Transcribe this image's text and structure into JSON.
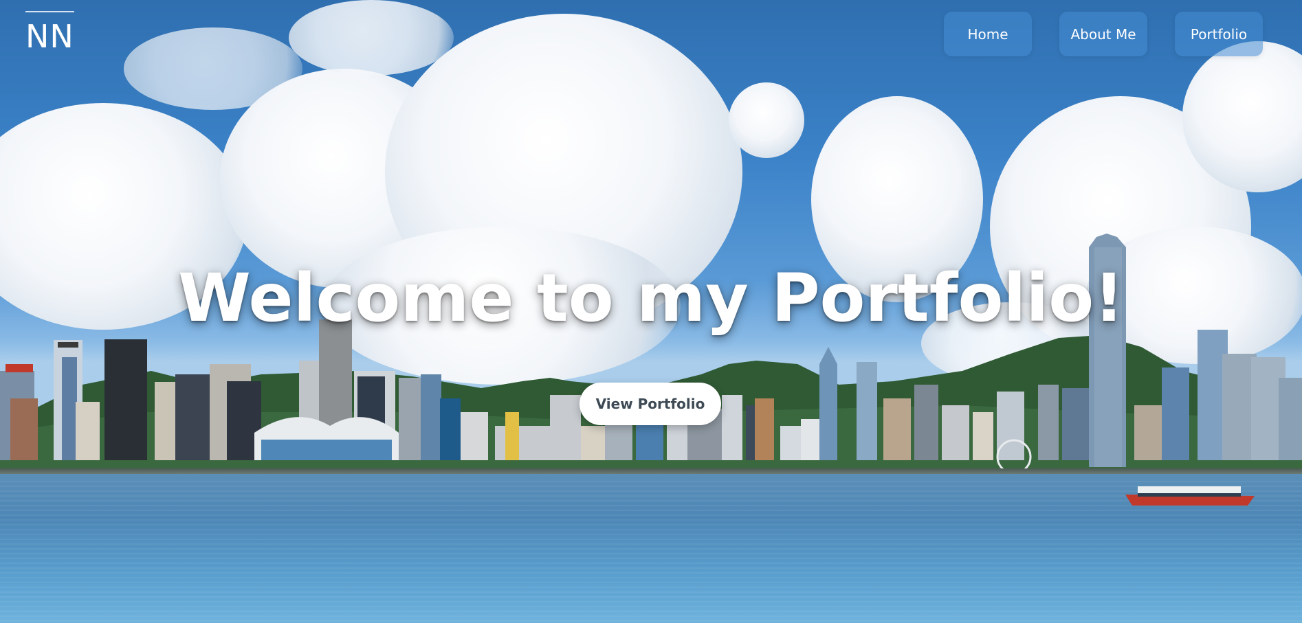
{
  "logo": {
    "text": "NN"
  },
  "nav": {
    "items": [
      {
        "label": "Home"
      },
      {
        "label": "About Me"
      },
      {
        "label": "Portfolio"
      }
    ]
  },
  "hero": {
    "headline": "Welcome to my Portfolio!",
    "cta_label": "View Portfolio",
    "background": "hong-kong-skyline-harbor-photo"
  },
  "colors": {
    "nav_button_bg": "#468cd2",
    "headline": "#ffffff",
    "cta_bg": "#ffffff",
    "cta_text": "#3d4a55"
  }
}
